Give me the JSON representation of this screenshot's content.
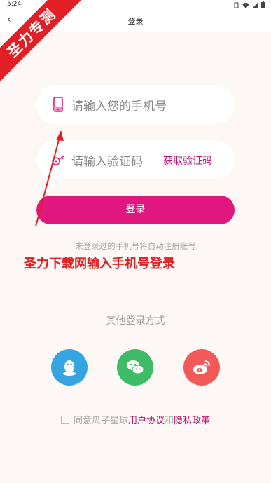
{
  "status": {
    "time": "5:24"
  },
  "nav": {
    "title": "登录",
    "back_icon": "back-arrow-icon"
  },
  "banner": {
    "text": "圣力专测"
  },
  "form": {
    "phone_placeholder": "请输入您的手机号",
    "code_placeholder": "请输入验证码",
    "get_code_label": "获取验证码",
    "login_label": "登录"
  },
  "hint": "未登录过的手机号将自动注册账号",
  "annotation": "圣力下载网输入手机号登录",
  "other_login": {
    "title": "其他登录方式",
    "icons": [
      "qq-icon",
      "wechat-icon",
      "weibo-icon"
    ]
  },
  "agreement": {
    "prefix": "同意瓜子星球",
    "user_agreement": "用户协议",
    "and": "和",
    "privacy_policy": "隐私政策"
  },
  "colors": {
    "accent": "#e0177f",
    "link": "#b5136f",
    "annotation_red": "#e02020"
  }
}
